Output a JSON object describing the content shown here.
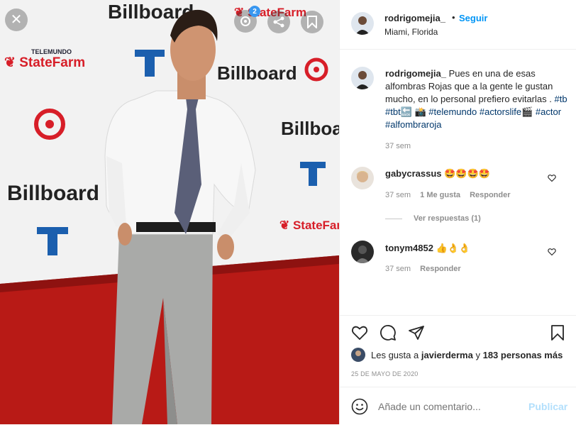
{
  "post": {
    "photo_alt": "Man in white shirt and grey tie on red carpet",
    "carousel_count": "2",
    "backdrop_logos": [
      "StateFarm",
      "PREMIOS Billboard",
      "TELEMUNDO"
    ]
  },
  "header": {
    "username": "rodrigomejia_",
    "separator": "•",
    "follow_label": "Seguir",
    "location": "Miami, Florida"
  },
  "caption": {
    "username": "rodrigomejia_",
    "text": "Pues en una de esas alfombras Rojas que a la gente le gustan mucho, en lo personal prefiero evitarlas .",
    "tags_line1": "#tb #tbt🔙 📸 #telemundo",
    "tags_line2": "#actorslife🎬 #actor #alfombraroja",
    "time": "37 sem"
  },
  "comments": [
    {
      "username": "gabycrassus",
      "text": "🤩🤩🤩🤩",
      "time": "37 sem",
      "likes": "1 Me gusta",
      "reply_label": "Responder",
      "view_replies": "Ver respuestas (1)"
    },
    {
      "username": "tonym4852",
      "text": "👍👌👌",
      "time": "37 sem",
      "reply_label": "Responder"
    }
  ],
  "likes": {
    "prefix": "Les gusta a",
    "user": "javierderma",
    "connector": "y",
    "count": "183 personas más"
  },
  "date": "25 DE MAYO DE 2020",
  "add_comment": {
    "placeholder": "Añade un comentario...",
    "publish_label": "Publicar"
  },
  "colors": {
    "accent": "#0095f6",
    "publish_disabled": "#b2dffc",
    "carpet": "#b81a16"
  }
}
